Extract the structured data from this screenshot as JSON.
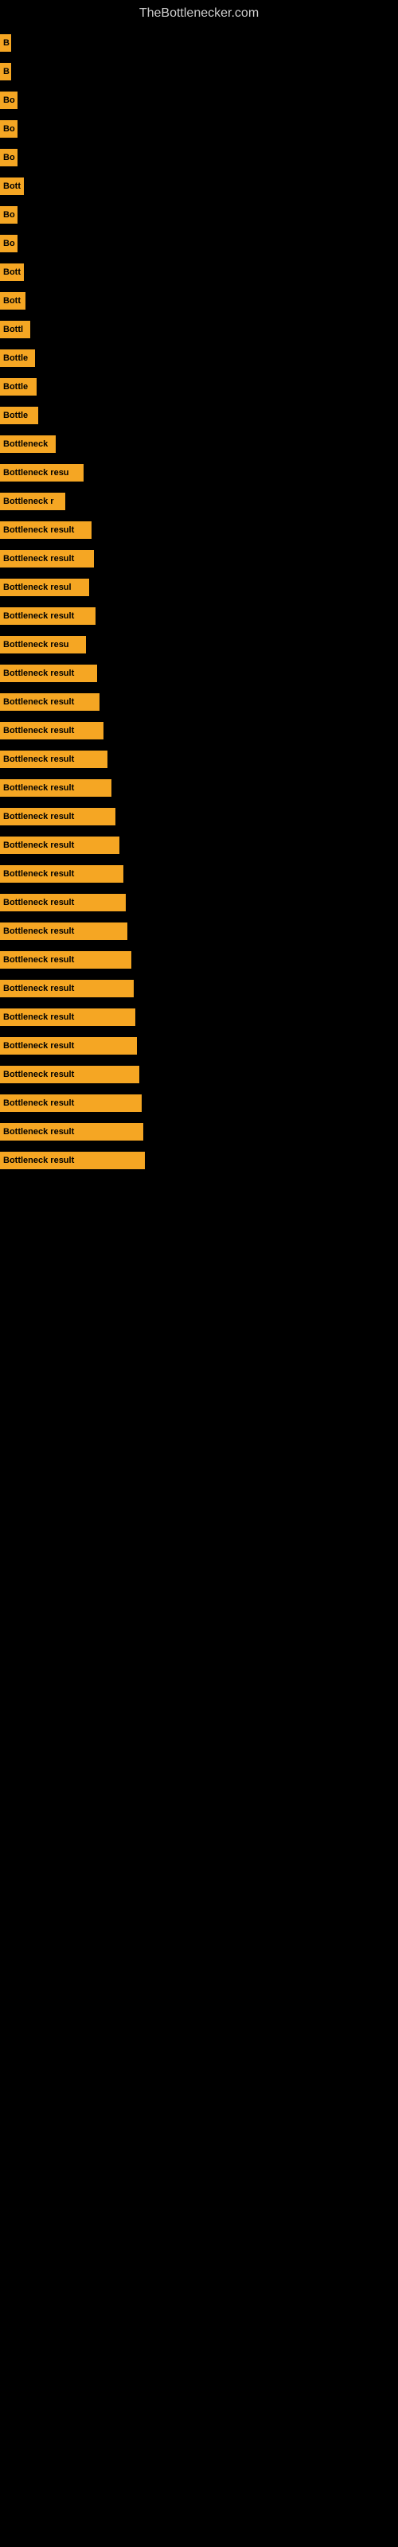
{
  "site": {
    "title": "TheBottlenecker.com"
  },
  "bars": [
    {
      "label": "B",
      "width": 14
    },
    {
      "label": "B",
      "width": 14
    },
    {
      "label": "Bo",
      "width": 22
    },
    {
      "label": "Bo",
      "width": 22
    },
    {
      "label": "Bo",
      "width": 22
    },
    {
      "label": "Bott",
      "width": 30
    },
    {
      "label": "Bo",
      "width": 22
    },
    {
      "label": "Bo",
      "width": 22
    },
    {
      "label": "Bott",
      "width": 30
    },
    {
      "label": "Bott",
      "width": 32
    },
    {
      "label": "Bottl",
      "width": 38
    },
    {
      "label": "Bottle",
      "width": 44
    },
    {
      "label": "Bottle",
      "width": 46
    },
    {
      "label": "Bottle",
      "width": 48
    },
    {
      "label": "Bottleneck",
      "width": 70
    },
    {
      "label": "Bottleneck resu",
      "width": 105
    },
    {
      "label": "Bottleneck r",
      "width": 82
    },
    {
      "label": "Bottleneck result",
      "width": 115
    },
    {
      "label": "Bottleneck result",
      "width": 118
    },
    {
      "label": "Bottleneck resul",
      "width": 112
    },
    {
      "label": "Bottleneck result",
      "width": 120
    },
    {
      "label": "Bottleneck resu",
      "width": 108
    },
    {
      "label": "Bottleneck result",
      "width": 122
    },
    {
      "label": "Bottleneck result",
      "width": 125
    },
    {
      "label": "Bottleneck result",
      "width": 130
    },
    {
      "label": "Bottleneck result",
      "width": 135
    },
    {
      "label": "Bottleneck result",
      "width": 140
    },
    {
      "label": "Bottleneck result",
      "width": 145
    },
    {
      "label": "Bottleneck result",
      "width": 150
    },
    {
      "label": "Bottleneck result",
      "width": 155
    },
    {
      "label": "Bottleneck result",
      "width": 158
    },
    {
      "label": "Bottleneck result",
      "width": 160
    },
    {
      "label": "Bottleneck result",
      "width": 165
    },
    {
      "label": "Bottleneck result",
      "width": 168
    },
    {
      "label": "Bottleneck result",
      "width": 170
    },
    {
      "label": "Bottleneck result",
      "width": 172
    },
    {
      "label": "Bottleneck result",
      "width": 175
    },
    {
      "label": "Bottleneck result",
      "width": 178
    },
    {
      "label": "Bottleneck result",
      "width": 180
    },
    {
      "label": "Bottleneck result",
      "width": 182
    }
  ]
}
